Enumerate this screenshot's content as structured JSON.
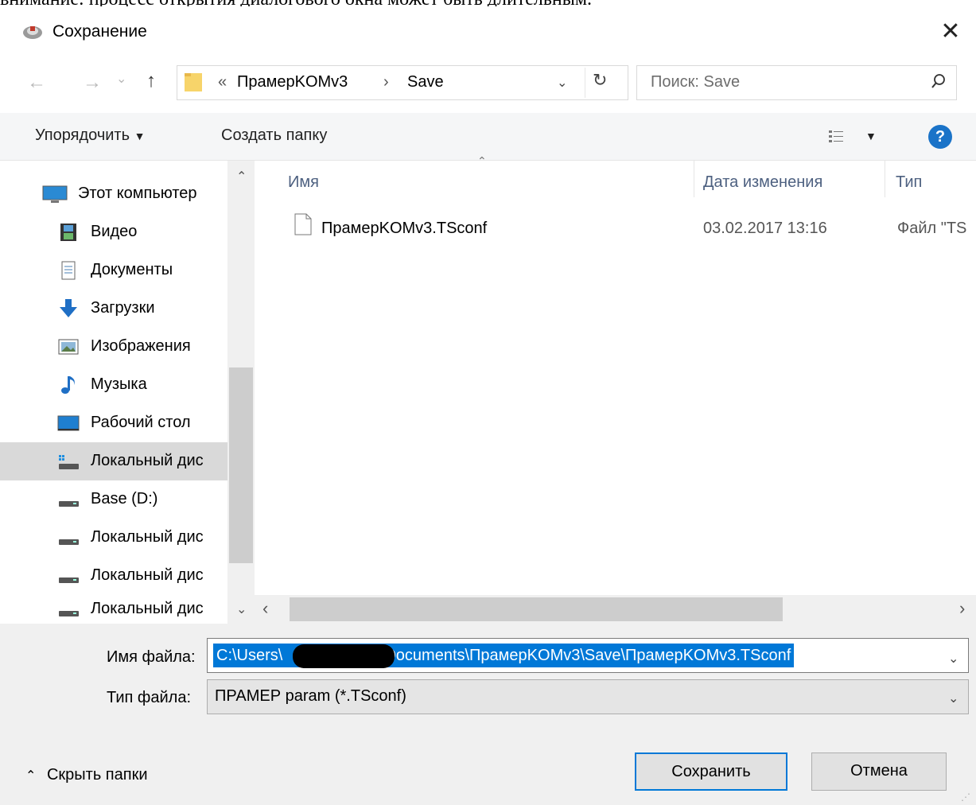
{
  "background_text": "внимание: процесс открытия диалогового окна может быть длительным.",
  "window": {
    "title": "Сохранение",
    "close_glyph": "✕"
  },
  "nav": {
    "back_glyph": "←",
    "forward_glyph": "→",
    "recent_glyph": "⌄",
    "up_glyph": "↑",
    "breadcrumb_prefix": "«",
    "breadcrumb": [
      "ПрамерKOMv3",
      "Save"
    ],
    "breadcrumb_sep": "›",
    "dropdown_glyph": "⌄",
    "refresh_glyph": "↻",
    "search_placeholder": "Поиск: Save",
    "search_glyph": "⚲"
  },
  "toolbar": {
    "organize_label": "Упорядочить",
    "organize_arrow": "▼",
    "new_folder_label": "Создать папку",
    "view_arrow": "▼",
    "help_label": "?"
  },
  "sidebar": {
    "items": [
      {
        "label": "Этот компьютер",
        "icon": "computer-icon"
      },
      {
        "label": "Видео",
        "icon": "video-icon"
      },
      {
        "label": "Документы",
        "icon": "documents-icon"
      },
      {
        "label": "Загрузки",
        "icon": "download-icon"
      },
      {
        "label": "Изображения",
        "icon": "pictures-icon"
      },
      {
        "label": "Музыка",
        "icon": "music-icon"
      },
      {
        "label": "Рабочий стол",
        "icon": "desktop-icon"
      },
      {
        "label": "Локальный дис",
        "icon": "system-drive-icon",
        "selected": true
      },
      {
        "label": "Base (D:)",
        "icon": "drive-icon"
      },
      {
        "label": "Локальный дис",
        "icon": "drive-icon"
      },
      {
        "label": "Локальный дис",
        "icon": "drive-icon"
      },
      {
        "label": "Локальный дис",
        "icon": "drive-icon"
      }
    ],
    "scroll_up": "⌃",
    "scroll_down": "⌄"
  },
  "filelist": {
    "columns": {
      "name": "Имя",
      "date": "Дата изменения",
      "type": "Тип"
    },
    "sort_glyph": "⌃",
    "rows": [
      {
        "name": "ПрамерKOMv3.TSconf",
        "date": "03.02.2017 13:16",
        "type": "Файл \"TS"
      }
    ],
    "scroll_left": "‹",
    "scroll_right": "›"
  },
  "form": {
    "filename_label": "Имя файла:",
    "filename_value_start": "C:\\Users\\",
    "filename_value_end": "Documents\\ПрамерKOMv3\\Save\\ПрамерKOMv3.TSconf",
    "filetype_label": "Тип файла:",
    "filetype_value": "ПРАМЕР param (*.TSconf)",
    "dropdown_glyph": "⌄"
  },
  "buttons": {
    "hide_folders_glyph": "⌃",
    "hide_folders": "Скрыть папки",
    "save": "Сохранить",
    "cancel": "Отмена"
  },
  "colors": {
    "accent": "#0078d7",
    "selection": "#0078d7",
    "sidebar_selected": "#d9d9d9",
    "help": "#1a73c8"
  }
}
